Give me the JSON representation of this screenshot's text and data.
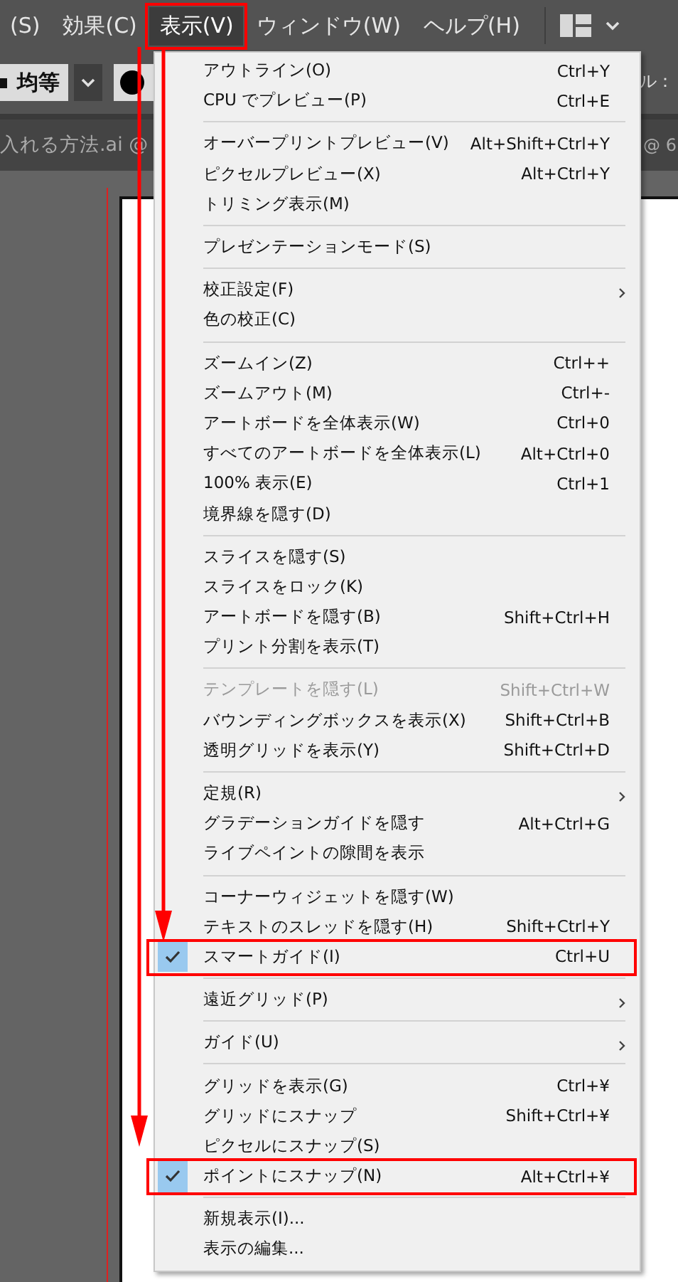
{
  "menubar": {
    "items": [
      {
        "label": "(S)",
        "selected": false,
        "annotated": false
      },
      {
        "label": "効果(C)",
        "selected": false,
        "annotated": false
      },
      {
        "label": "表示(V)",
        "selected": true,
        "annotated": true
      },
      {
        "label": "ウィンドウ(W)",
        "selected": false,
        "annotated": false
      },
      {
        "label": "ヘルプ(H)",
        "selected": false,
        "annotated": false
      }
    ]
  },
  "control_bar": {
    "stroke_profile": "均等",
    "right_label": "ル："
  },
  "document_tabs": {
    "left_title": "入れる方法.ai @",
    "right_title": "@ 6"
  },
  "view_menu": {
    "groups": [
      {
        "items": [
          {
            "label": "アウトライン(O)",
            "shortcut": "Ctrl+Y"
          },
          {
            "label": "CPU でプレビュー(P)",
            "shortcut": "Ctrl+E"
          }
        ]
      },
      {
        "items": [
          {
            "label": "オーバープリントプレビュー(V)",
            "shortcut": "Alt+Shift+Ctrl+Y"
          },
          {
            "label": "ピクセルプレビュー(X)",
            "shortcut": "Alt+Ctrl+Y"
          },
          {
            "label": "トリミング表示(M)"
          }
        ]
      },
      {
        "items": [
          {
            "label": "プレゼンテーションモード(S)"
          }
        ]
      },
      {
        "items": [
          {
            "label": "校正設定(F)",
            "submenu": true
          },
          {
            "label": "色の校正(C)"
          }
        ]
      },
      {
        "items": [
          {
            "label": "ズームイン(Z)",
            "shortcut": "Ctrl++"
          },
          {
            "label": "ズームアウト(M)",
            "shortcut": "Ctrl+-"
          },
          {
            "label": "アートボードを全体表示(W)",
            "shortcut": "Ctrl+0"
          },
          {
            "label": "すべてのアートボードを全体表示(L)",
            "shortcut": "Alt+Ctrl+0"
          },
          {
            "label": "100% 表示(E)",
            "shortcut": "Ctrl+1"
          },
          {
            "label": "境界線を隠す(D)"
          }
        ]
      },
      {
        "items": [
          {
            "label": "スライスを隠す(S)"
          },
          {
            "label": "スライスをロック(K)"
          },
          {
            "label": "アートボードを隠す(B)",
            "shortcut": "Shift+Ctrl+H"
          },
          {
            "label": "プリント分割を表示(T)"
          }
        ]
      },
      {
        "items": [
          {
            "label": "テンプレートを隠す(L)",
            "shortcut": "Shift+Ctrl+W",
            "disabled": true
          },
          {
            "label": "バウンディングボックスを表示(X)",
            "shortcut": "Shift+Ctrl+B"
          },
          {
            "label": "透明グリッドを表示(Y)",
            "shortcut": "Shift+Ctrl+D"
          }
        ]
      },
      {
        "items": [
          {
            "label": "定規(R)",
            "submenu": true
          },
          {
            "label": "グラデーションガイドを隠す",
            "shortcut": "Alt+Ctrl+G"
          },
          {
            "label": "ライブペイントの隙間を表示"
          }
        ]
      },
      {
        "items": [
          {
            "label": "コーナーウィジェットを隠す(W)"
          },
          {
            "label": "テキストのスレッドを隠す(H)",
            "shortcut": "Shift+Ctrl+Y"
          },
          {
            "label": "スマートガイド(I)",
            "shortcut": "Ctrl+U",
            "checked": true,
            "annotated": true
          }
        ]
      },
      {
        "items": [
          {
            "label": "遠近グリッド(P)",
            "submenu": true
          }
        ]
      },
      {
        "items": [
          {
            "label": "ガイド(U)",
            "submenu": true
          }
        ]
      },
      {
        "items": [
          {
            "label": "グリッドを表示(G)",
            "shortcut": "Ctrl+¥"
          },
          {
            "label": "グリッドにスナップ",
            "shortcut": "Shift+Ctrl+¥"
          },
          {
            "label": "ピクセルにスナップ(S)"
          },
          {
            "label": "ポイントにスナップ(N)",
            "shortcut": "Alt+Ctrl+¥",
            "checked": true,
            "annotated": true
          }
        ]
      },
      {
        "items": [
          {
            "label": "新規表示(I)..."
          },
          {
            "label": "表示の編集..."
          }
        ]
      }
    ]
  }
}
